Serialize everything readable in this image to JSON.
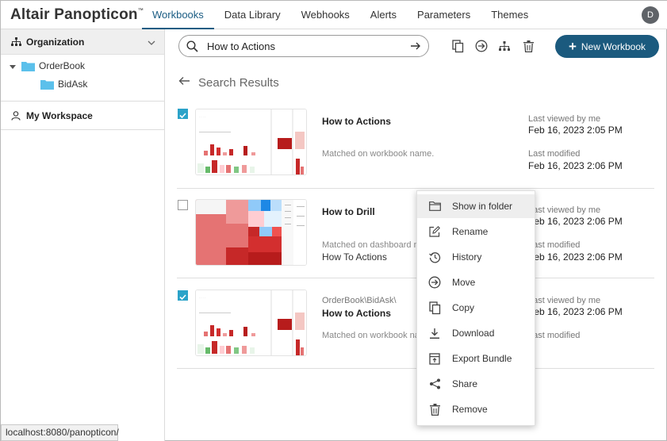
{
  "app": {
    "brand": "Altair Panopticon",
    "brand_mark": "™",
    "user_initial": "D"
  },
  "nav": {
    "tabs": [
      {
        "label": "Workbooks",
        "active": true
      },
      {
        "label": "Data Library"
      },
      {
        "label": "Webhooks"
      },
      {
        "label": "Alerts"
      },
      {
        "label": "Parameters"
      },
      {
        "label": "Themes"
      }
    ]
  },
  "sidebar": {
    "organization_label": "Organization",
    "tree": [
      {
        "label": "OrderBook",
        "expanded": true
      },
      {
        "label": "BidAsk"
      }
    ],
    "workspace_label": "My Workspace"
  },
  "toolbar": {
    "search_value": "How to Actions",
    "new_workbook_label": "New Workbook",
    "icons": [
      "copy-icon",
      "move-icon",
      "hierarchy-icon",
      "trash-icon"
    ]
  },
  "results": {
    "heading": "Search Results",
    "items": [
      {
        "checked": true,
        "path": "",
        "title": "How to Actions",
        "match": "Matched on workbook name.",
        "sub": "",
        "last_viewed_label": "Last viewed by me",
        "last_viewed": "Feb 16, 2023 2:05 PM",
        "last_modified_label": "Last modified",
        "last_modified": "Feb 16, 2023 2:06 PM"
      },
      {
        "checked": false,
        "path": "",
        "title": "How to Drill",
        "match": "Matched on dashboard name",
        "sub": "How To Actions",
        "last_viewed_label": "Last viewed by me",
        "last_viewed": "Feb 16, 2023 2:06 PM",
        "last_modified_label": "Last modified",
        "last_modified": "Feb 16, 2023 2:06 PM"
      },
      {
        "checked": true,
        "path": "OrderBook\\BidAsk\\",
        "title": "How to Actions",
        "match": "Matched on workbook name.",
        "sub": "",
        "last_viewed_label": "Last viewed by me",
        "last_viewed": "Feb 16, 2023 2:06 PM",
        "last_modified_label": "Last modified",
        "last_modified": ""
      }
    ]
  },
  "context_menu": {
    "items": [
      {
        "label": "Show in folder",
        "icon": "folder-icon",
        "hover": true
      },
      {
        "label": "Rename",
        "icon": "edit-icon"
      },
      {
        "label": "History",
        "icon": "history-icon"
      },
      {
        "label": "Move",
        "icon": "move-icon"
      },
      {
        "label": "Copy",
        "icon": "copy-icon"
      },
      {
        "label": "Download",
        "icon": "download-icon"
      },
      {
        "label": "Export Bundle",
        "icon": "export-bundle-icon"
      },
      {
        "label": "Share",
        "icon": "share-icon"
      },
      {
        "label": "Remove",
        "icon": "trash-icon"
      }
    ]
  },
  "statusbar": {
    "url": "localhost:8080/panopticon/"
  },
  "colors": {
    "accent": "#1b5a7e",
    "check": "#2ba3c9",
    "folder": "#5bc0eb"
  }
}
